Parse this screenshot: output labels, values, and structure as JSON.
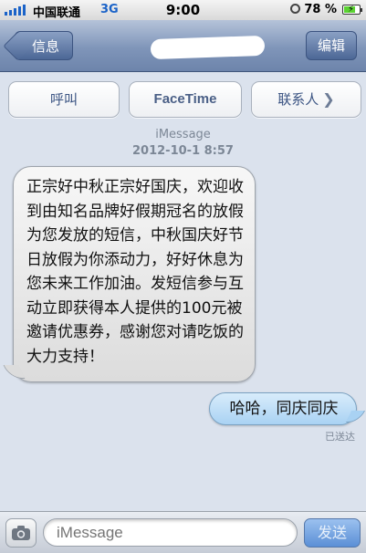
{
  "status_bar": {
    "carrier": "中国联通",
    "network": "3G",
    "time": "9:00",
    "battery": "78 %",
    "battery_level": 0.78
  },
  "navbar": {
    "back_label": "信息",
    "title_redacted": true,
    "edit_label": "编辑"
  },
  "actions": {
    "call_label": "呼叫",
    "facetime_label": "FaceTime",
    "contact_label": "联系人"
  },
  "conversation": {
    "service": "iMessage",
    "timestamp": "2012-10-1 8:57",
    "incoming_text": "正宗好中秋正宗好国庆，欢迎收到由知名品牌好假期冠名的放假为您发放的短信，中秋国庆好节日放假为你添动力，好好休息为您未来工作加油。发短信参与互动立即获得本人提供的100元被邀请优惠券，感谢您对请吃饭的大力支持！",
    "outgoing_text": "哈哈，同庆同庆",
    "delivered_label": "已送达"
  },
  "input_bar": {
    "placeholder": "iMessage",
    "send_label": "发送"
  },
  "colors": {
    "outgoing_bubble": "#a9d2f3",
    "incoming_bubble": "#dcdcdc",
    "navbar": "#7f95b9",
    "background": "#dbe2ed"
  },
  "icons": [
    "signal-icon",
    "clock-icon",
    "battery-icon",
    "camera-icon",
    "chevron-right-icon"
  ]
}
